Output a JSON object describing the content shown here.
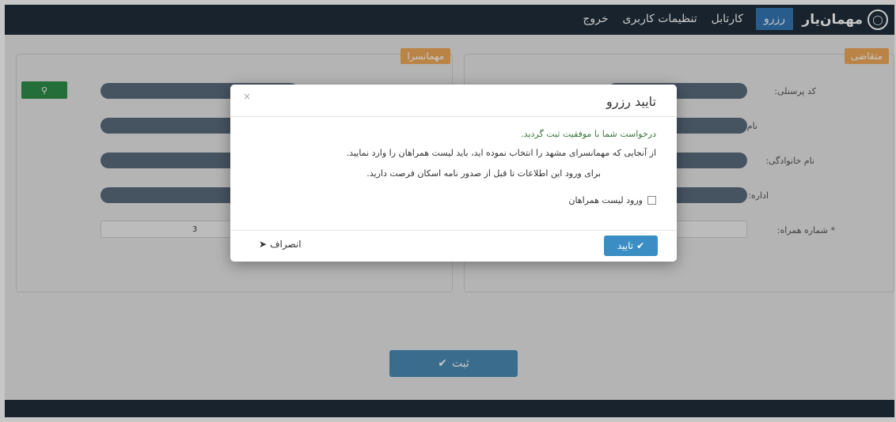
{
  "navbar": {
    "brand": "مهمان‌یار",
    "brand_icon": "logo-badge-icon",
    "items": [
      {
        "label": "رزرو",
        "active": true
      },
      {
        "label": "کارتابل",
        "active": false
      },
      {
        "label": "تنظیمات کاربری",
        "active": false
      },
      {
        "label": "خروج",
        "active": false
      }
    ]
  },
  "panels": {
    "requester": {
      "tag": "متقاضی",
      "fields": {
        "personnel_code": "کد پرسنلی:",
        "first_name": "نام:",
        "last_name": "نام خانوادگی:",
        "office": "اداره:",
        "companions": "* شماره همراه:"
      }
    },
    "guesthouse": {
      "tag": "مهمانسرا",
      "search_icon": "search-icon",
      "companion_count": "3"
    }
  },
  "submit": {
    "label": "ثبت",
    "icon": "check-circle-icon"
  },
  "modal": {
    "title": "تایید رزرو",
    "success": "درخواست شما با موفقیت ثبت گردید.",
    "line1": "از آنجایی که مهمانسرای مشهد را انتخاب نموده اید، باید لیست همراهان را وارد نمایید.",
    "line2": "برای ورود این اطلاعات تا قبل از صدور نامه اسکان فرصت دارید.",
    "checkbox_label": "ورود لیست همراهان",
    "confirm_label": "تایید",
    "cancel_label": "انصراف",
    "close_glyph": "×"
  },
  "colors": {
    "navbar": "#1f2d3a",
    "active_nav": "#3277b4",
    "tag": "#f0a95b",
    "search": "#2e8e4a",
    "submit": "#4b8bb6",
    "confirm": "#3a8ec4"
  }
}
